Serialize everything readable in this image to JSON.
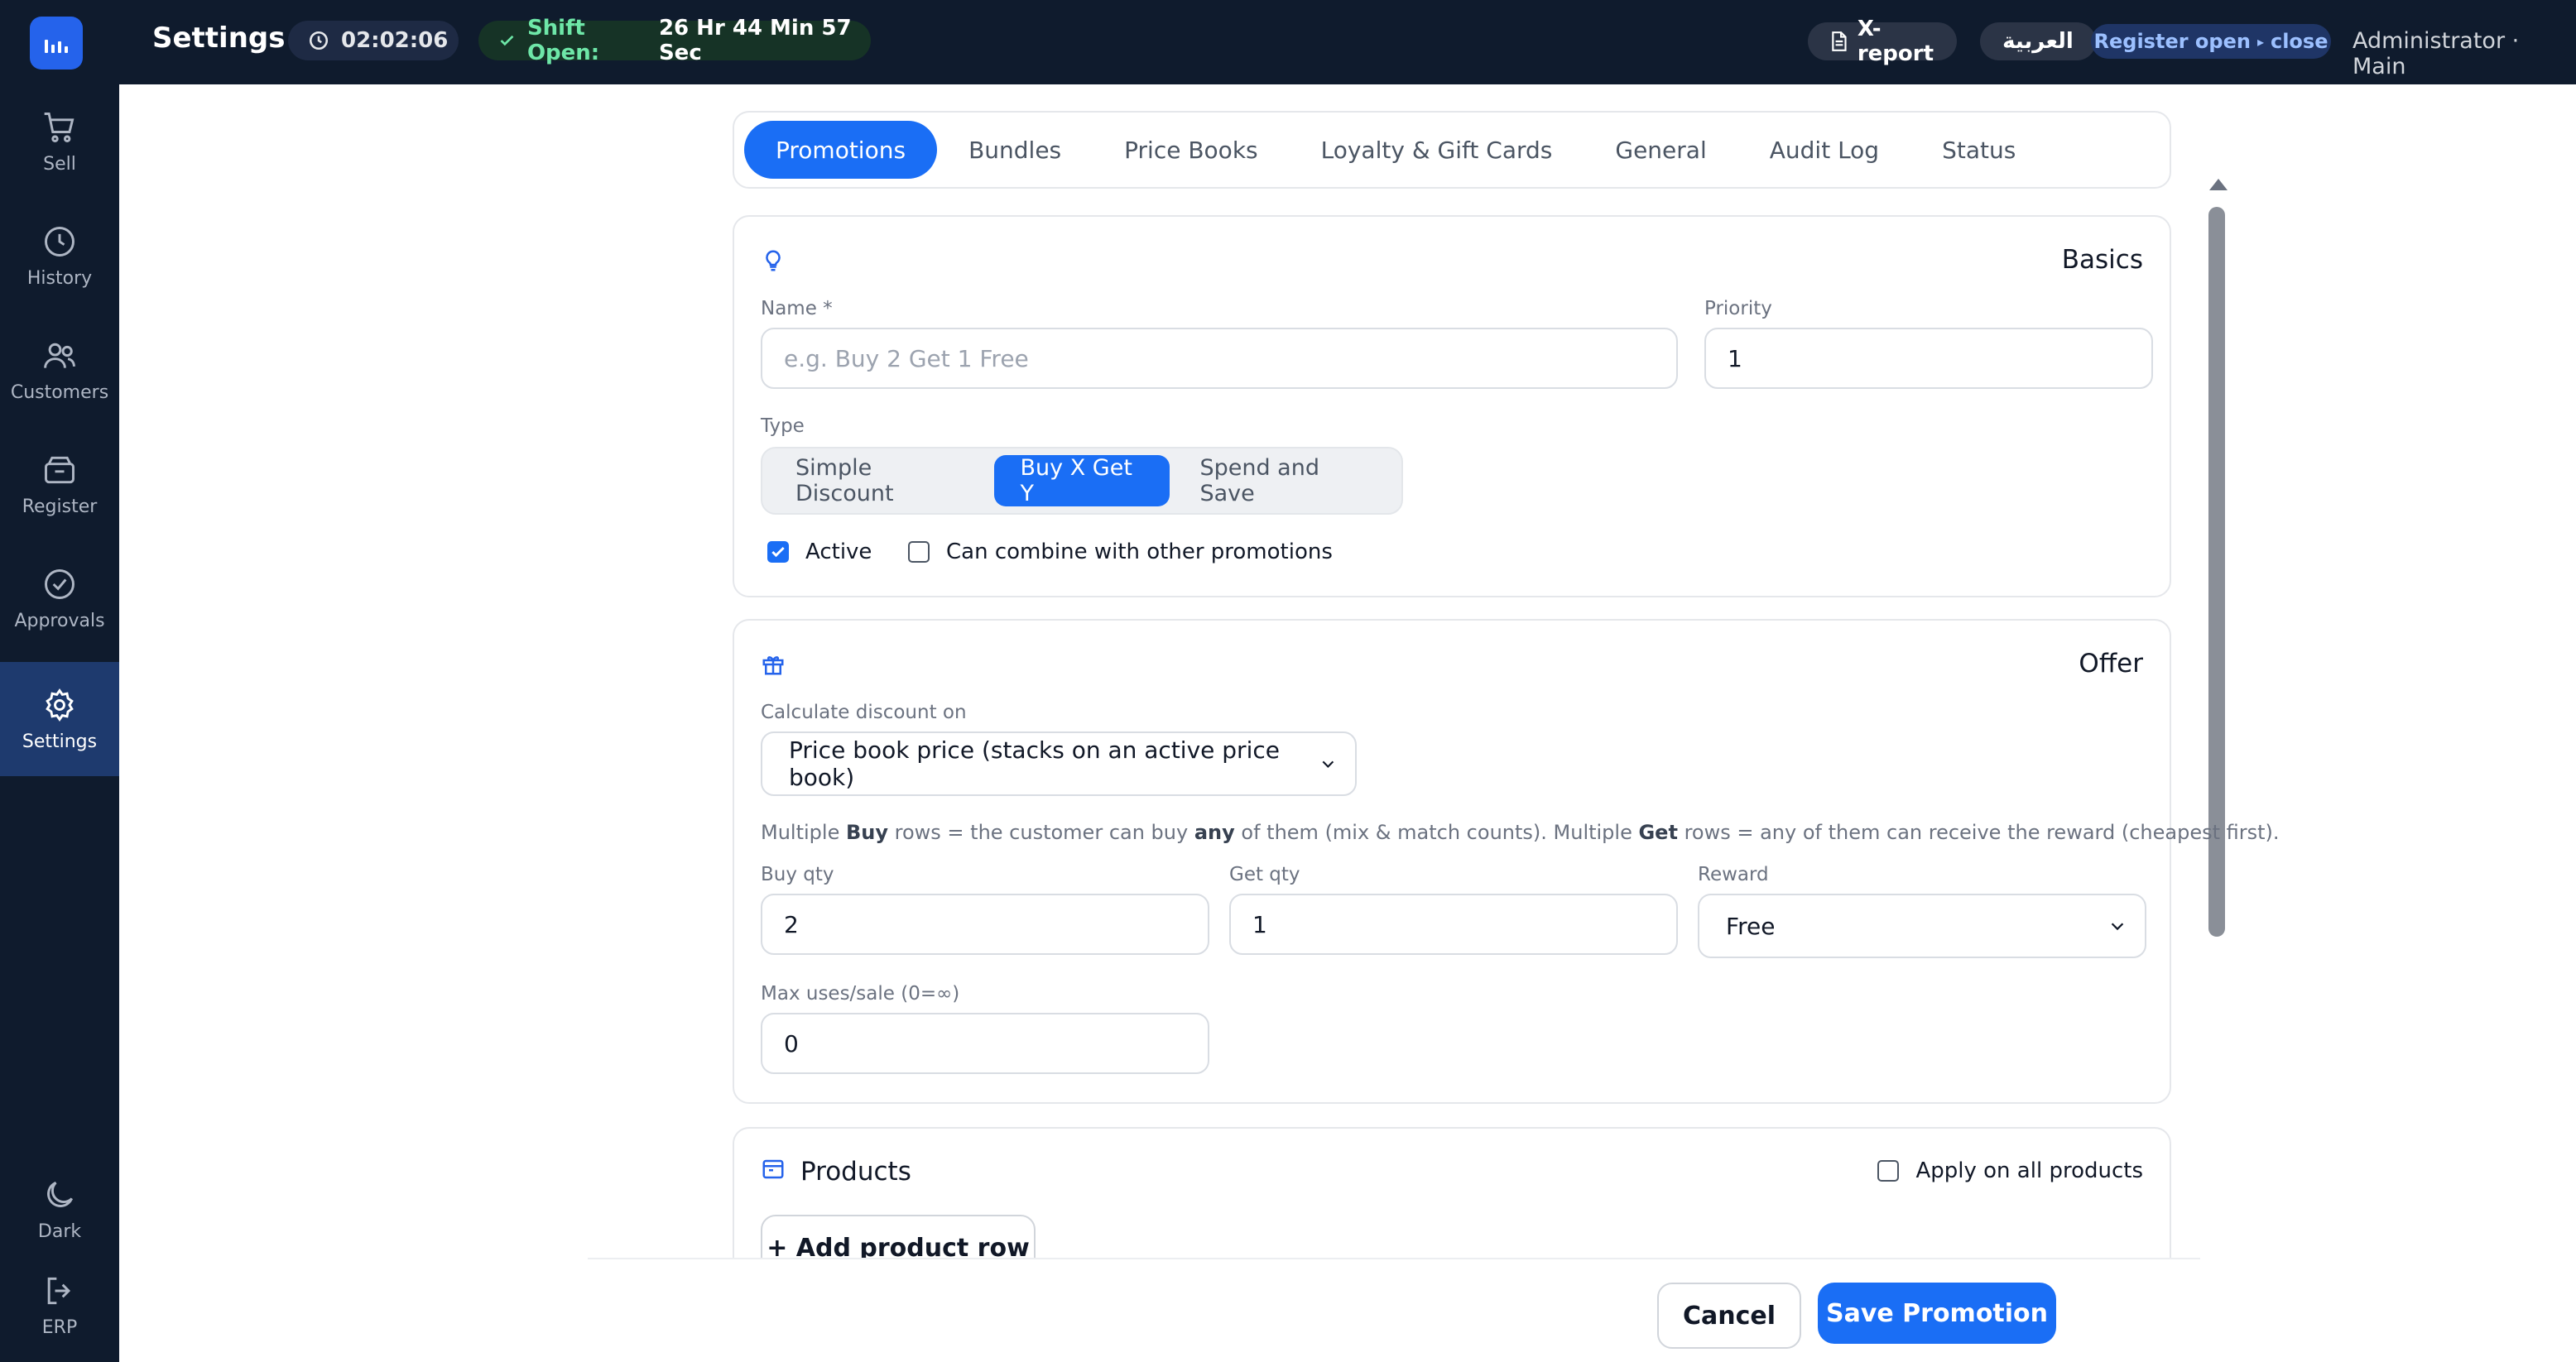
{
  "header": {
    "title": "Settings",
    "timer": "02:02:06",
    "shift_label": "Shift Open:",
    "shift_value": "26 Hr 44 Min 57 Sec",
    "xreport": "X-report",
    "language": "العربية",
    "register_status": "Register open",
    "register_separator": "▸",
    "register_close": "close",
    "user": "Administrator · Main"
  },
  "sidebar": {
    "items": [
      {
        "label": "Sell",
        "icon": "cart-icon"
      },
      {
        "label": "History",
        "icon": "clock-icon"
      },
      {
        "label": "Customers",
        "icon": "users-icon"
      },
      {
        "label": "Register",
        "icon": "register-icon"
      },
      {
        "label": "Approvals",
        "icon": "check-circle-icon"
      },
      {
        "label": "Settings",
        "icon": "gear-icon"
      }
    ],
    "bottom": [
      {
        "label": "Dark",
        "icon": "moon-icon"
      },
      {
        "label": "ERP",
        "icon": "logout-icon"
      }
    ]
  },
  "tabs": [
    "Promotions",
    "Bundles",
    "Price Books",
    "Loyalty & Gift Cards",
    "General",
    "Audit Log",
    "Status"
  ],
  "basics": {
    "title": "Basics",
    "name_label": "Name *",
    "name_placeholder": "e.g. Buy 2 Get 1 Free",
    "priority_label": "Priority",
    "priority_value": "1",
    "type_label": "Type",
    "types": [
      "Simple Discount",
      "Buy X Get Y",
      "Spend and Save"
    ],
    "selected_type": "Buy X Get Y",
    "active_label": "Active",
    "active_checked": true,
    "combine_label": "Can combine with other promotions",
    "combine_checked": false
  },
  "offer": {
    "title": "Offer",
    "calc_label": "Calculate discount on",
    "calc_value": "Price book price (stacks on an active price book)",
    "hint": {
      "p1": "Multiple ",
      "b1": "Buy",
      "p2": " rows = the customer can buy ",
      "b2": "any",
      "p3": " of them (mix & match counts). Multiple ",
      "b3": "Get",
      "p4": " rows = any of them can receive the reward (cheapest first)."
    },
    "buy_qty_label": "Buy qty",
    "buy_qty_value": "2",
    "get_qty_label": "Get qty",
    "get_qty_value": "1",
    "reward_label": "Reward",
    "reward_value": "Free",
    "max_uses_label": "Max uses/sale (0=∞)",
    "max_uses_value": "0"
  },
  "products": {
    "title": "Products",
    "apply_all_label": "Apply on all products",
    "apply_all_checked": false,
    "add_row": "+ Add product row"
  },
  "footer": {
    "cancel": "Cancel",
    "save": "Save Promotion"
  },
  "colors": {
    "primary": "#1a6ef5",
    "sidebar": "#0f1b2d",
    "shift_green": "#6ee7a8"
  }
}
